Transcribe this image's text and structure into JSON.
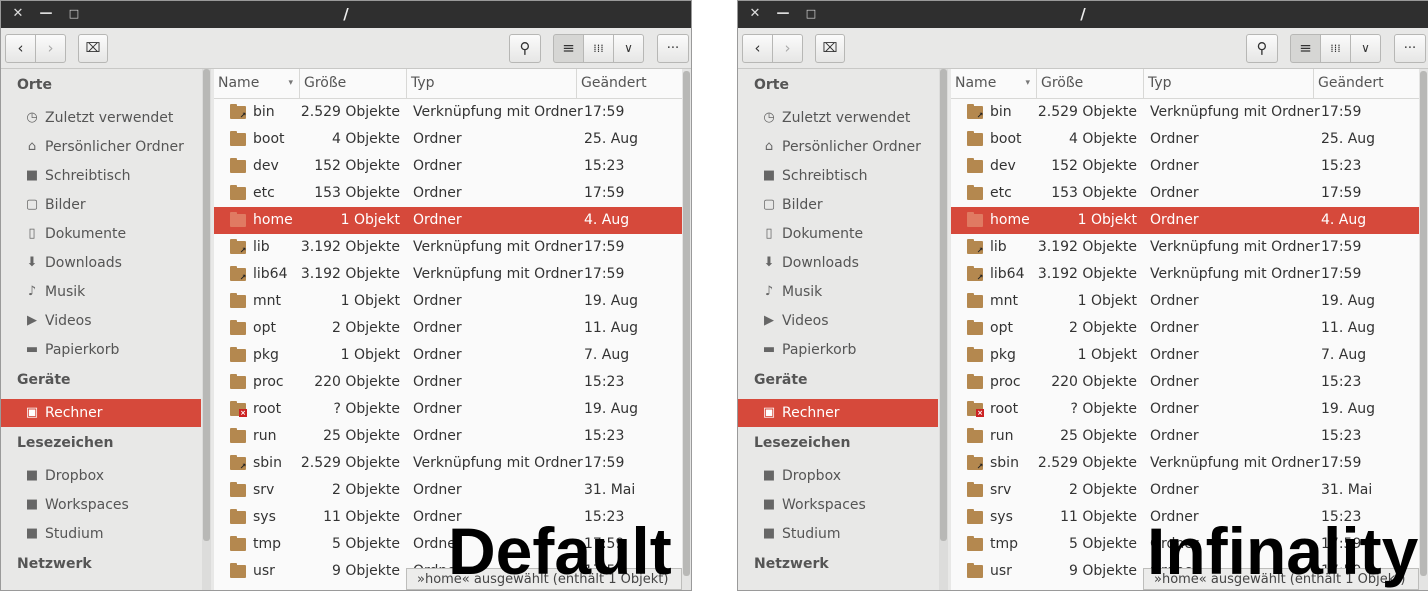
{
  "window_title": "/",
  "titlebar": {
    "close_label": "✕",
    "minimize_label": "—",
    "maximize_label": "□"
  },
  "toolbar": {
    "back_label": "‹",
    "forward_label": "›",
    "location_label": "⌧",
    "search_label": "⚲",
    "list_label": "≡",
    "grid_label": "⁞⁞⁞",
    "view_menu_label": "∨",
    "more_label": "···"
  },
  "sidebar": {
    "sections": [
      {
        "heading": "Orte",
        "items": [
          {
            "label": "Zuletzt verwendet",
            "icon": "clock-icon",
            "glyph": "◷"
          },
          {
            "label": "Persönlicher Ordner",
            "icon": "home-icon",
            "glyph": "⌂"
          },
          {
            "label": "Schreibtisch",
            "icon": "desktop-folder-icon",
            "glyph": "■"
          },
          {
            "label": "Bilder",
            "icon": "pictures-icon",
            "glyph": "▢"
          },
          {
            "label": "Dokumente",
            "icon": "document-icon",
            "glyph": "▯"
          },
          {
            "label": "Downloads",
            "icon": "download-icon",
            "glyph": "⬇"
          },
          {
            "label": "Musik",
            "icon": "music-icon",
            "glyph": "♪"
          },
          {
            "label": "Videos",
            "icon": "video-icon",
            "glyph": "▶"
          },
          {
            "label": "Papierkorb",
            "icon": "trash-icon",
            "glyph": "▬"
          }
        ]
      },
      {
        "heading": "Geräte",
        "items": [
          {
            "label": "Rechner",
            "icon": "computer-icon",
            "glyph": "▣",
            "active": true
          }
        ]
      },
      {
        "heading": "Lesezeichen",
        "items": [
          {
            "label": "Dropbox",
            "icon": "folder-icon",
            "glyph": "■"
          },
          {
            "label": "Workspaces",
            "icon": "folder-icon",
            "glyph": "■"
          },
          {
            "label": "Studium",
            "icon": "folder-icon",
            "glyph": "■"
          }
        ]
      },
      {
        "heading": "Netzwerk",
        "items": []
      }
    ]
  },
  "columns": {
    "name": "Name",
    "size": "Größe",
    "type": "Typ",
    "modified": "Geändert",
    "sort_indicator": "▾"
  },
  "files": [
    {
      "name": "bin",
      "size": "2.529 Objekte",
      "type": "Verknüpfung mit Ordner",
      "modified": "17:59",
      "link": true
    },
    {
      "name": "boot",
      "size": "4 Objekte",
      "type": "Ordner",
      "modified": "25. Aug"
    },
    {
      "name": "dev",
      "size": "152 Objekte",
      "type": "Ordner",
      "modified": "15:23"
    },
    {
      "name": "etc",
      "size": "153 Objekte",
      "type": "Ordner",
      "modified": "17:59"
    },
    {
      "name": "home",
      "size": "1 Objekt",
      "type": "Ordner",
      "modified": "4. Aug",
      "selected": true
    },
    {
      "name": "lib",
      "size": "3.192 Objekte",
      "type": "Verknüpfung mit Ordner",
      "modified": "17:59",
      "link": true
    },
    {
      "name": "lib64",
      "size": "3.192 Objekte",
      "type": "Verknüpfung mit Ordner",
      "modified": "17:59",
      "link": true
    },
    {
      "name": "mnt",
      "size": "1 Objekt",
      "type": "Ordner",
      "modified": "19. Aug"
    },
    {
      "name": "opt",
      "size": "2 Objekte",
      "type": "Ordner",
      "modified": "11. Aug"
    },
    {
      "name": "pkg",
      "size": "1 Objekt",
      "type": "Ordner",
      "modified": "7. Aug"
    },
    {
      "name": "proc",
      "size": "220 Objekte",
      "type": "Ordner",
      "modified": "15:23"
    },
    {
      "name": "root",
      "size": "? Objekte",
      "type": "Ordner",
      "modified": "19. Aug",
      "locked": true
    },
    {
      "name": "run",
      "size": "25 Objekte",
      "type": "Ordner",
      "modified": "15:23"
    },
    {
      "name": "sbin",
      "size": "2.529 Objekte",
      "type": "Verknüpfung mit Ordner",
      "modified": "17:59",
      "link": true
    },
    {
      "name": "srv",
      "size": "2 Objekte",
      "type": "Ordner",
      "modified": "31. Mai"
    },
    {
      "name": "sys",
      "size": "11 Objekte",
      "type": "Ordner",
      "modified": "15:23"
    },
    {
      "name": "tmp",
      "size": "5 Objekte",
      "type": "Ordner",
      "modified": "17:59"
    },
    {
      "name": "usr",
      "size": "9 Objekte",
      "type": "Ordner",
      "modified": "17:59"
    }
  ],
  "status_text": "»home« ausgewählt  (enthält 1 Objekt)",
  "overlays": [
    "Default",
    "Infinality"
  ],
  "colors": {
    "accent": "#d6493b",
    "folder": "#b4884f",
    "titlebar": "#2f2f2f"
  }
}
